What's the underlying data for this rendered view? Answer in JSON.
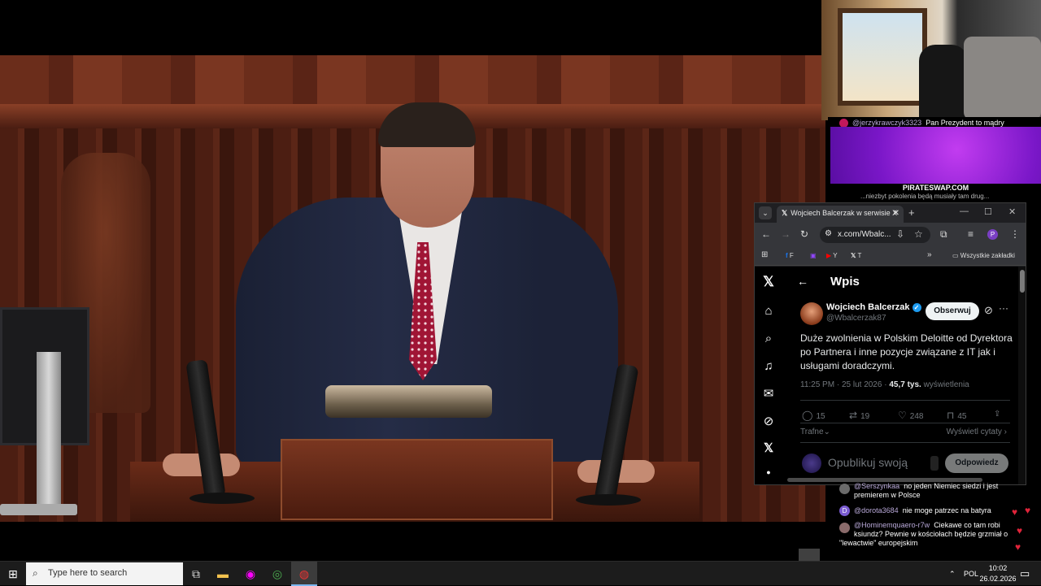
{
  "stream": {
    "chat_top": {
      "message": {
        "user": "@jerzykrawczyk3323",
        "text": "Pan Prezydent to mądry"
      },
      "ad_label": "PIRATESWAP.COM",
      "cut_text": "...niezbyt pokolenia będą musiały tam drug..."
    },
    "chat_bottom": [
      {
        "user": "@Serszynkaa",
        "text": "no jeden Niemiec siedzi i jest premierem w Polsce",
        "avatar_color": "#6b6b6b"
      },
      {
        "user": "@dorota3684",
        "text": "nie moge patrzec na batyra",
        "avatar_color": "#7a5bd1",
        "avatar_letter": "D"
      },
      {
        "user": "@Hominemquaero-r7w",
        "text": "Ciekawe co tam robi ksiundz? Pewnie w kościołach będzie grzmiał o \"lewactwie\" europejskim",
        "avatar_color": "#8a6b6b"
      }
    ]
  },
  "browser": {
    "tab_title": "Wojciech Balcerzak w serwisie X",
    "url": "x.com/Wbalc...",
    "bookmarks": [
      "F",
      "Y",
      "T"
    ],
    "all_bookmarks": "Wszystkie zakładki",
    "profile_letter": "P"
  },
  "tweet": {
    "page_title": "Wpis",
    "author_name": "Wojciech Balcerzak",
    "author_handle": "@Wbalcerzak87",
    "follow_label": "Obserwuj",
    "text": "Duże zwolnienia w Polskim Deloitte od Dyrektora po Partnera i inne pozycje związane z IT jak i usługami doradczymi.",
    "time": "11:25 PM · 25 lut 2026 · ",
    "views_count": "45,7 tys.",
    "views_label": " wyświetlenia",
    "stats": {
      "replies": "15",
      "reposts": "19",
      "likes": "248",
      "bookmarks": "45"
    },
    "sort_label": "Trafne",
    "quotes_label": "Wyświetl cytaty",
    "reply_placeholder": "Opublikuj swoją",
    "reply_button": "Odpowiedz"
  },
  "taskbar": {
    "search_placeholder": "Type here to search",
    "language": "POL",
    "time": "10:02",
    "date": "26.02.2026"
  }
}
